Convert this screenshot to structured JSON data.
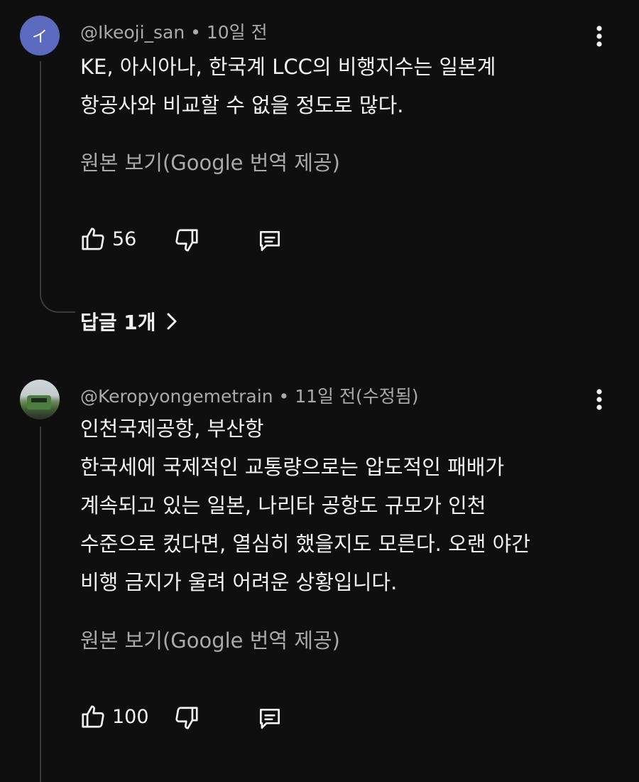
{
  "comments": [
    {
      "avatar_letter": "イ",
      "avatar_color": "#5c6bc0",
      "author": "@Ikeoji_san",
      "separator": "•",
      "time": "10일 전",
      "lines": [
        "KE, 아시아나, 한국계 LCC의 비행지수는 일본계",
        "항공사와 비교할 수 없을 정도로 많다."
      ],
      "translate_link": "원본 보기(Google 번역 제공)",
      "like_count": "56",
      "replies_label": "답글 1개"
    },
    {
      "avatar_icon": "train-photo-avatar",
      "author": "@Keropyongemetrain",
      "separator": "•",
      "time": "11일 전(수정됨)",
      "lines": [
        "인천국제공항, 부산항",
        "한국세에 국제적인 교통량으로는 압도적인 패배가",
        "계속되고 있는 일본, 나리타 공항도 규모가 인천",
        "수준으로 컸다면, 열심히 했을지도 모른다. 오랜 야간",
        "비행 금지가 울려 어려운 상황입니다."
      ],
      "translate_link": "원본 보기(Google 번역 제공)",
      "like_count": "100"
    }
  ],
  "icons": {
    "like": "thumb-up-icon",
    "dislike": "thumb-down-icon",
    "reply": "comment-reply-icon",
    "more": "more-vert-icon",
    "chevron": "chevron-right-icon"
  },
  "colors": {
    "background": "#0f0f0f",
    "primary_text": "#f1f1f1",
    "secondary_text": "#aaaaaa",
    "thread_line": "#3a3a3a"
  }
}
